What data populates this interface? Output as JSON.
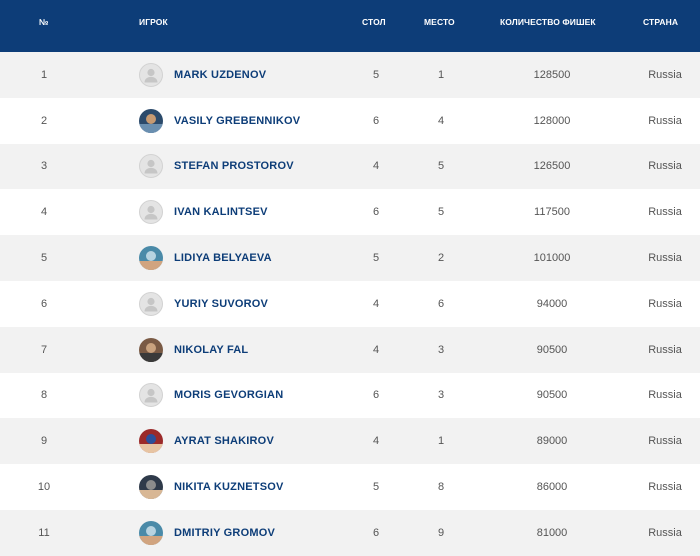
{
  "header": {
    "num": "№",
    "player": "ИГРОК",
    "table": "СТОЛ",
    "place": "МЕСТО",
    "chips": "КОЛИЧЕСТВО ФИШЕК",
    "country": "СТРАНА"
  },
  "rows": [
    {
      "num": "1",
      "name": "MARK UZDENOV",
      "table": "5",
      "place": "1",
      "chips": "128500",
      "country": "Russia",
      "avatar": "placeholder-user-icon"
    },
    {
      "num": "2",
      "name": "VASILY GREBENNIKOV",
      "table": "6",
      "place": "4",
      "chips": "128000",
      "country": "Russia",
      "avatar": "player-photo"
    },
    {
      "num": "3",
      "name": "STEFAN PROSTOROV",
      "table": "4",
      "place": "5",
      "chips": "126500",
      "country": "Russia",
      "avatar": "placeholder-user-icon"
    },
    {
      "num": "4",
      "name": "IVAN KALINTSEV",
      "table": "6",
      "place": "5",
      "chips": "117500",
      "country": "Russia",
      "avatar": "placeholder-user-icon"
    },
    {
      "num": "5",
      "name": "LIDIYA BELYAEVA",
      "table": "5",
      "place": "2",
      "chips": "101000",
      "country": "Russia",
      "avatar": "player-photo"
    },
    {
      "num": "6",
      "name": "YURIY SUVOROV",
      "table": "4",
      "place": "6",
      "chips": "94000",
      "country": "Russia",
      "avatar": "placeholder-user-icon"
    },
    {
      "num": "7",
      "name": "NIKOLAY FAL",
      "table": "4",
      "place": "3",
      "chips": "90500",
      "country": "Russia",
      "avatar": "player-photo"
    },
    {
      "num": "8",
      "name": "MORIS GEVORGIAN",
      "table": "6",
      "place": "3",
      "chips": "90500",
      "country": "Russia",
      "avatar": "placeholder-user-icon"
    },
    {
      "num": "9",
      "name": "AYRAT SHAKIROV",
      "table": "4",
      "place": "1",
      "chips": "89000",
      "country": "Russia",
      "avatar": "player-photo"
    },
    {
      "num": "10",
      "name": "NIKITA KUZNETSOV",
      "table": "5",
      "place": "8",
      "chips": "86000",
      "country": "Russia",
      "avatar": "player-photo"
    },
    {
      "num": "11",
      "name": "DMITRIY GROMOV",
      "table": "6",
      "place": "9",
      "chips": "81000",
      "country": "Russia",
      "avatar": "player-photo"
    }
  ],
  "colors": {
    "header_bg": "#0d3d78",
    "name_text": "#0d3d78",
    "row_stripe": "#f2f2f2"
  }
}
